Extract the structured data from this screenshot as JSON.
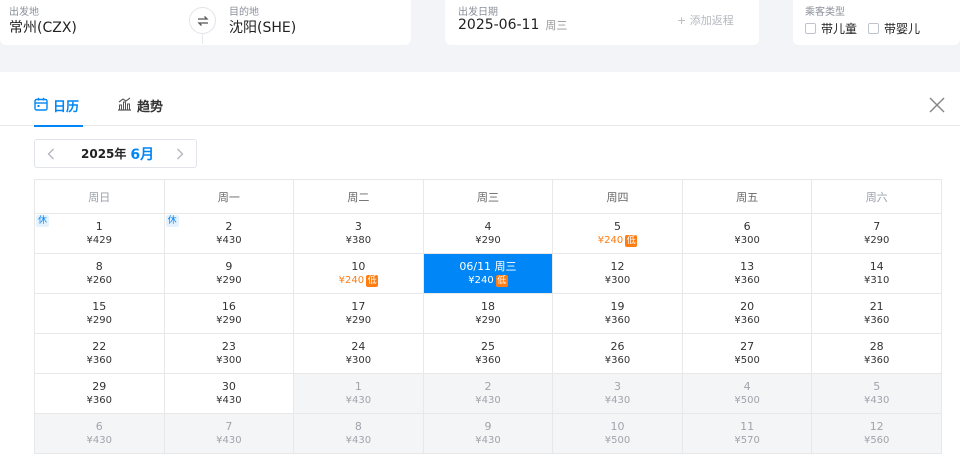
{
  "search": {
    "departure": {
      "label": "出发地",
      "value": "常州(CZX)"
    },
    "destination": {
      "label": "目的地",
      "value": "沈阳(SHE)"
    },
    "date": {
      "label": "出发日期",
      "value": "2025-06-11",
      "weekday": "周三"
    },
    "add_return": "+ 添加返程",
    "passenger": {
      "label": "乘客类型",
      "child": "带儿童",
      "infant": "带婴儿"
    }
  },
  "tabs": {
    "calendar": "日历",
    "trend": "趋势"
  },
  "month_nav": {
    "year": "2025年",
    "month": "6月"
  },
  "weekdays": [
    "周日",
    "周一",
    "周二",
    "周三",
    "周四",
    "周五",
    "周六"
  ],
  "low_badge": "低",
  "holiday_tag": "休",
  "calendar": {
    "rows": [
      [
        {
          "day": "1",
          "price": "¥429",
          "holiday": true
        },
        {
          "day": "2",
          "price": "¥430",
          "holiday": true
        },
        {
          "day": "3",
          "price": "¥380"
        },
        {
          "day": "4",
          "price": "¥290"
        },
        {
          "day": "5",
          "price": "¥240",
          "low": true
        },
        {
          "day": "6",
          "price": "¥300"
        },
        {
          "day": "7",
          "price": "¥290"
        }
      ],
      [
        {
          "day": "8",
          "price": "¥260"
        },
        {
          "day": "9",
          "price": "¥290"
        },
        {
          "day": "10",
          "price": "¥240",
          "low": true
        },
        {
          "day": "06/11 周三",
          "price": "¥240",
          "low": true,
          "selected": true
        },
        {
          "day": "12",
          "price": "¥300"
        },
        {
          "day": "13",
          "price": "¥360"
        },
        {
          "day": "14",
          "price": "¥310"
        }
      ],
      [
        {
          "day": "15",
          "price": "¥290"
        },
        {
          "day": "16",
          "price": "¥290"
        },
        {
          "day": "17",
          "price": "¥290"
        },
        {
          "day": "18",
          "price": "¥290"
        },
        {
          "day": "19",
          "price": "¥360"
        },
        {
          "day": "20",
          "price": "¥360"
        },
        {
          "day": "21",
          "price": "¥360"
        }
      ],
      [
        {
          "day": "22",
          "price": "¥360"
        },
        {
          "day": "23",
          "price": "¥300"
        },
        {
          "day": "24",
          "price": "¥300"
        },
        {
          "day": "25",
          "price": "¥360"
        },
        {
          "day": "26",
          "price": "¥360"
        },
        {
          "day": "27",
          "price": "¥500"
        },
        {
          "day": "28",
          "price": "¥360"
        }
      ],
      [
        {
          "day": "29",
          "price": "¥360"
        },
        {
          "day": "30",
          "price": "¥430"
        },
        {
          "day": "1",
          "price": "¥430",
          "other": true
        },
        {
          "day": "2",
          "price": "¥430",
          "other": true
        },
        {
          "day": "3",
          "price": "¥430",
          "other": true
        },
        {
          "day": "4",
          "price": "¥500",
          "other": true
        },
        {
          "day": "5",
          "price": "¥430",
          "other": true
        }
      ],
      [
        {
          "day": "6",
          "price": "¥430",
          "other": true
        },
        {
          "day": "7",
          "price": "¥430",
          "other": true
        },
        {
          "day": "8",
          "price": "¥430",
          "other": true
        },
        {
          "day": "9",
          "price": "¥430",
          "other": true
        },
        {
          "day": "10",
          "price": "¥500",
          "other": true
        },
        {
          "day": "11",
          "price": "¥570",
          "other": true
        },
        {
          "day": "12",
          "price": "¥560",
          "other": true
        }
      ]
    ]
  },
  "icons": {
    "swap": "swap-arrows-icon",
    "calendar": "calendar-icon",
    "trend": "bar-chart-icon",
    "close": "close-icon",
    "prev": "chevron-left-icon",
    "next": "chevron-right-icon"
  },
  "colors": {
    "accent": "#0086f6",
    "low_price": "#ff7d13",
    "other_month_bg": "#f4f5f7"
  }
}
